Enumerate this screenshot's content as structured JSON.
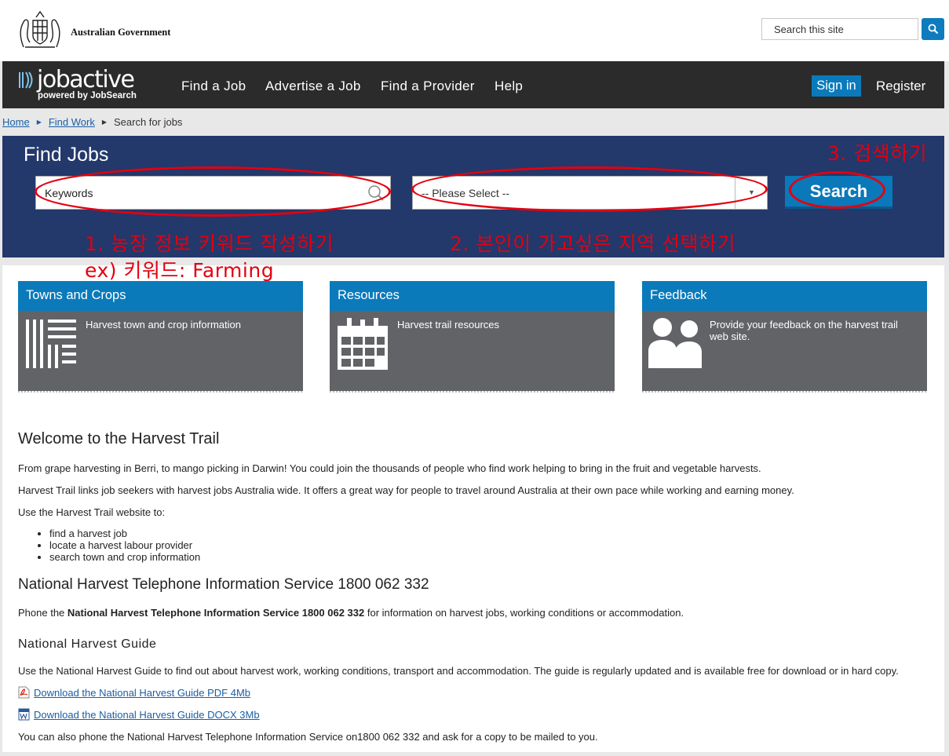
{
  "gov": {
    "name": "Australian Government",
    "search_placeholder": "Search this site"
  },
  "brand": {
    "name": "jobactive",
    "tagline": "powered by JobSearch"
  },
  "nav": {
    "items": [
      "Find a Job",
      "Advertise a Job",
      "Find a Provider",
      "Help"
    ],
    "sign_in": "Sign in",
    "register": "Register"
  },
  "breadcrumb": [
    "Home",
    "Find Work",
    "Search for jobs"
  ],
  "find_jobs": {
    "title": "Find Jobs",
    "keywords_value": "Keywords",
    "location_value": "-- Please Select --",
    "search_label": "Search"
  },
  "annotations": {
    "step1": "1. 농장 정보 키워드 작성하기",
    "step1_example": "ex) 키워드: Farming",
    "step2": "2. 본인이 가고싶은 지역 선택하기",
    "step3": "3. 검색하기",
    "color": "#e3000f"
  },
  "tiles": [
    {
      "title": "Towns and Crops",
      "text": "Harvest town and crop information",
      "icon": "towns-crops-icon"
    },
    {
      "title": "Resources",
      "text": "Harvest trail resources",
      "icon": "calendar-icon"
    },
    {
      "title": "Feedback",
      "text": "Provide your feedback on the harvest trail web site.",
      "icon": "people-icon"
    }
  ],
  "welcome": {
    "heading": "Welcome to the Harvest Trail",
    "p1": "From grape harvesting in Berri, to mango picking in Darwin! You could join the thousands of people who find work helping to bring in the fruit and vegetable harvests.",
    "p2": "Harvest Trail links job seekers with harvest jobs Australia wide. It offers a great way for people to travel around Australia at their own pace while working and earning money.",
    "p3": "Use the Harvest Trail website to:",
    "list": [
      "find a harvest job",
      "locate a harvest labour provider",
      "search town and crop information"
    ]
  },
  "phone": {
    "heading": "National Harvest Telephone Information Service 1800 062 332",
    "pre": "Phone the ",
    "bold": "National Harvest Telephone Information Service 1800 062 332",
    "post": " for information on harvest jobs, working conditions or accommodation."
  },
  "guide": {
    "heading": "National Harvest Guide",
    "p": "Use the National Harvest Guide to find out about harvest work, working conditions, transport and accommodation. The guide is regularly updated and is available free for download or in hard copy.",
    "pdf_link": "Download the National Harvest Guide PDF 4Mb",
    "docx_link": "Download the National Harvest Guide DOCX 3Mb",
    "footer": "You can also phone the National Harvest Telephone Information Service on1800 062 332 and ask for a copy to be mailed to you."
  },
  "colors": {
    "accent": "#0a7abb",
    "navbar": "#2b2b2b",
    "find_panel": "#23386b",
    "tile_body": "#626366"
  }
}
